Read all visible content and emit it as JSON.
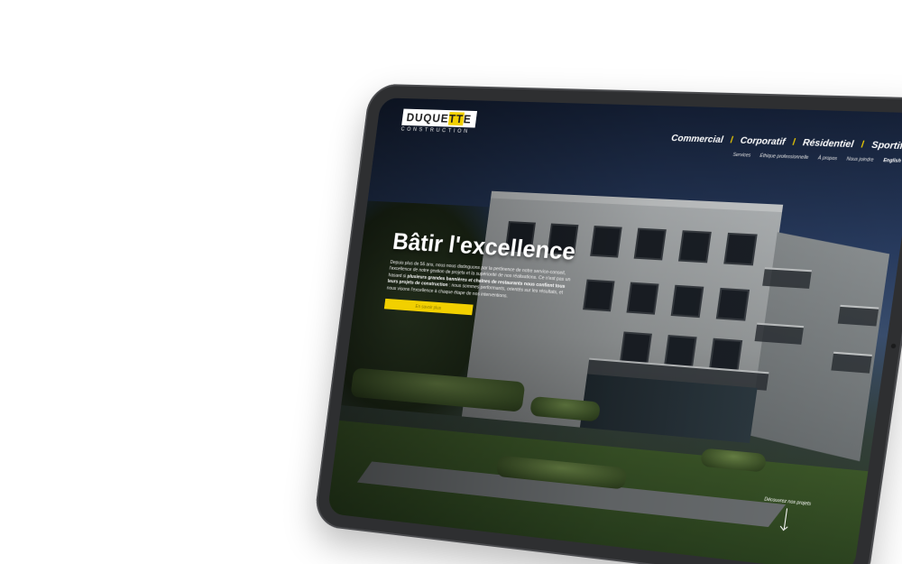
{
  "logo": {
    "main_prefix": "DUQUE",
    "main_accent": "TT",
    "main_suffix": "E",
    "sub": "CONSTRUCTION"
  },
  "nav_main": [
    {
      "label": "Commercial"
    },
    {
      "label": "Corporatif"
    },
    {
      "label": "Résidentiel"
    },
    {
      "label": "Sportif"
    }
  ],
  "nav_separator": "/",
  "nav_sub": [
    {
      "label": "Services"
    },
    {
      "label": "Éthique professionnelle"
    },
    {
      "label": "À propos"
    },
    {
      "label": "Nous joindre"
    },
    {
      "label": "English"
    }
  ],
  "hero": {
    "title": "Bâtir l'excellence",
    "text_1": "Depuis plus de 56 ans, nous nous distinguons par la pertinence de notre service-conseil, l'excellence de notre gestion de projets et la supériorité de nos réalisations. Ce n'est pas un hasard si ",
    "text_bold_1": "plusieurs grandes bannières et chaînes de restaurants nous confient tous leurs projets de construction",
    "text_2": " : nous sommes performants, orientés sur les résultats, et nous visons l'excellence à chaque étape de nos interventions.",
    "cta": "En savoir plus"
  },
  "discover": {
    "label": "Découvrez nos projets"
  },
  "colors": {
    "accent": "#f2d000",
    "device": "#2e2f31",
    "text": "#ffffff"
  }
}
